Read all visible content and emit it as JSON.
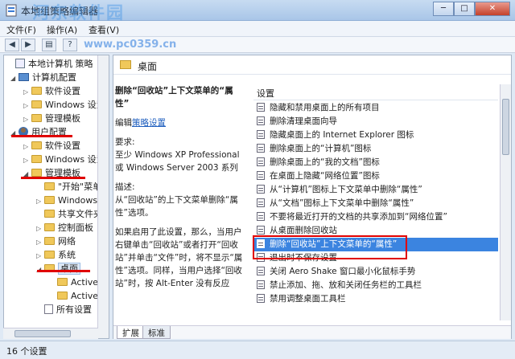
{
  "window": {
    "title": "本地组策略编辑器",
    "watermark": "河东软件园",
    "watermark_url": "www.pc0359.cn",
    "controls": {
      "minimize": "─",
      "maximize": "□",
      "close": "✕"
    }
  },
  "menu": {
    "items": [
      "文件(F)",
      "操作(A)",
      "查看(V)"
    ]
  },
  "toolbar": {
    "back": "◀",
    "forward": "▶",
    "view": "▤",
    "help": "?"
  },
  "tree": {
    "items": [
      {
        "label": "本地计算机 策略",
        "icon": "policy-root-icon",
        "expander": ""
      },
      {
        "label": "计算机配置",
        "icon": "computer-icon",
        "expander": "◢"
      },
      {
        "label": "软件设置",
        "icon": "folder-icon",
        "expander": "▷"
      },
      {
        "label": "Windows 设置",
        "icon": "folder-icon",
        "expander": "▷"
      },
      {
        "label": "管理模板",
        "icon": "folder-icon",
        "expander": "▷"
      },
      {
        "label": "用户配置",
        "icon": "user-icon",
        "expander": "◢"
      },
      {
        "label": "软件设置",
        "icon": "folder-icon",
        "expander": "▷"
      },
      {
        "label": "Windows 设置",
        "icon": "folder-icon",
        "expander": "▷"
      },
      {
        "label": "管理模板",
        "icon": "folder-icon",
        "expander": "◢"
      },
      {
        "label": "\"开始\"菜单",
        "icon": "folder-icon",
        "expander": ""
      },
      {
        "label": "Windows 组件",
        "icon": "folder-icon",
        "expander": "▷"
      },
      {
        "label": "共享文件夹",
        "icon": "folder-icon",
        "expander": ""
      },
      {
        "label": "控制面板",
        "icon": "folder-icon",
        "expander": "▷"
      },
      {
        "label": "网络",
        "icon": "folder-icon",
        "expander": "▷"
      },
      {
        "label": "系统",
        "icon": "folder-icon",
        "expander": "▷"
      },
      {
        "label": "桌面",
        "icon": "folder-icon",
        "expander": "◢"
      },
      {
        "label": "Active Dir",
        "icon": "folder-icon",
        "expander": ""
      },
      {
        "label": "Active Des",
        "icon": "folder-icon",
        "expander": ""
      },
      {
        "label": "所有设置",
        "icon": "document-icon",
        "expander": ""
      }
    ]
  },
  "details": {
    "folder_title": "桌面",
    "description": {
      "title": "删除“回收站”上下文菜单的“属性”",
      "edit_prefix": "编辑",
      "edit_link": "策略设置",
      "requirements_heading": "要求:",
      "requirements_text": "至少 Windows XP Professional 或 Windows Server 2003 系列",
      "description_heading": "描述:",
      "description_text": "从“回收站”的上下文菜单删除“属性”选项。",
      "detail_text": "如果启用了此设置，那么，当用户右键单击“回收站”或者打开“回收站”并单击“文件”时，将不显示“属性”选项。同样，当用户选择“回收站”时，按 Alt-Enter 没有反应"
    },
    "settings_header": "设置",
    "settings": [
      "隐藏和禁用桌面上的所有项目",
      "删除清理桌面向导",
      "隐藏桌面上的 Internet Explorer 图标",
      "删除桌面上的“计算机”图标",
      "删除桌面上的“我的文档”图标",
      "在桌面上隐藏“网络位置”图标",
      "从“计算机”图标上下文菜单中删除“属性”",
      "从“文档”图标上下文菜单中删除“属性”",
      "不要将最近打开的文档的共享添加到“网络位置”",
      "从桌面删除回收站",
      "删除“回收站”上下文菜单的“属性”",
      "退出时不保存设置",
      "关闭 Aero Shake 窗口最小化鼠标手势",
      "禁止添加、拖、放和关闭任务栏的工具栏",
      "禁用调整桌面工具栏"
    ],
    "selected_index": 10,
    "tabs": [
      "扩展",
      "标准"
    ]
  },
  "status": {
    "count_text": "16 个设置"
  },
  "colors": {
    "selection": "#3b84e0",
    "annotation": "#e00000",
    "link": "#1f5fbf"
  }
}
